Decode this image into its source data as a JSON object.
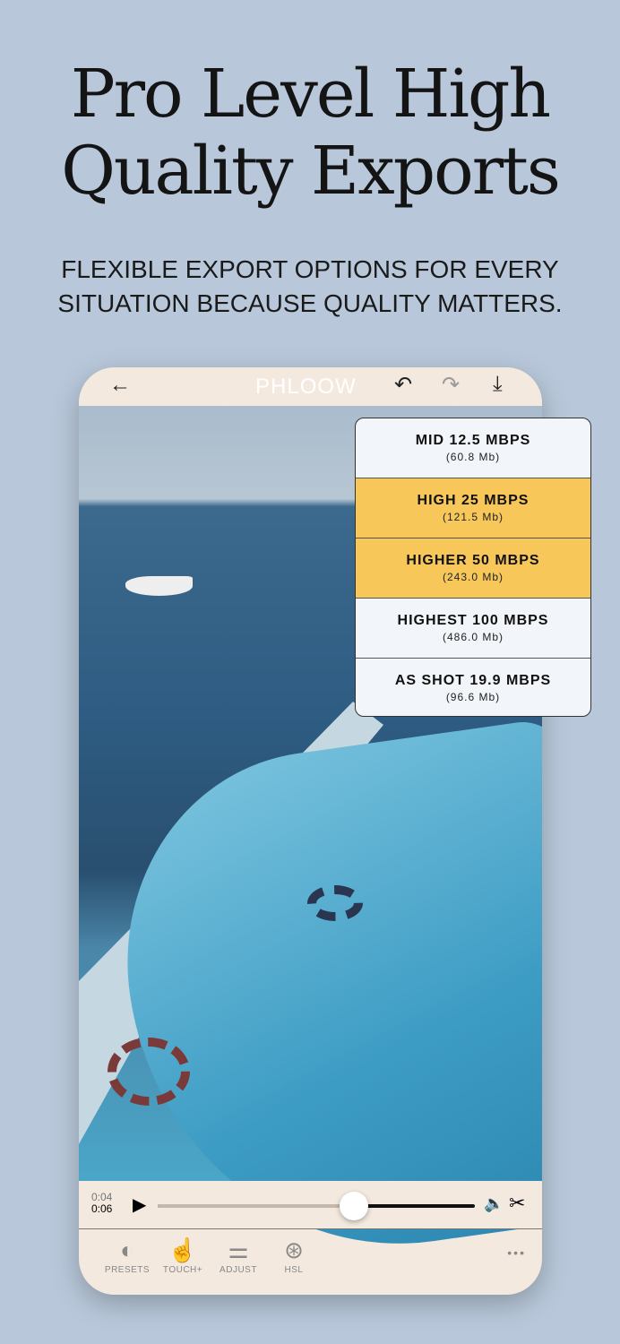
{
  "headline": {
    "line1": "Pro Level High",
    "line2": "Quality Exports"
  },
  "subhead": {
    "line1": "FLEXIBLE EXPORT OPTIONS FOR EVERY",
    "line2": "SITUATION BECAUSE QUALITY MATTERS."
  },
  "app": {
    "logo": "PHLOOW",
    "back": "←",
    "undo": "↶",
    "redo": "↷",
    "download": "⤓"
  },
  "player": {
    "current": "0:04",
    "total": "0:06",
    "progress": 0.62,
    "play": "▶",
    "volume": "🔈",
    "cut": "✂"
  },
  "tabs": [
    {
      "label": "PRESETS",
      "icon": "◐"
    },
    {
      "label": "TOUCH+",
      "icon": "☝"
    },
    {
      "label": "ADJUST",
      "icon": "⚌"
    },
    {
      "label": "HSL",
      "icon": "⊛"
    }
  ],
  "more": "•••",
  "export_options": [
    {
      "label": "MID 12.5 MBPS",
      "size": "(60.8 Mb)",
      "selected": false
    },
    {
      "label": "HIGH 25 MBPS",
      "size": "(121.5 Mb)",
      "selected": true
    },
    {
      "label": "HIGHER 50 MBPS",
      "size": "(243.0 Mb)",
      "selected": true
    },
    {
      "label": "HIGHEST 100 MBPS",
      "size": "(486.0 Mb)",
      "selected": false
    },
    {
      "label": "AS SHOT 19.9 MBPS",
      "size": "(96.6 Mb)",
      "selected": false
    }
  ],
  "colors": {
    "accent": "#f8c75a",
    "background": "#b8c8da",
    "panel": "#f3e9df"
  }
}
